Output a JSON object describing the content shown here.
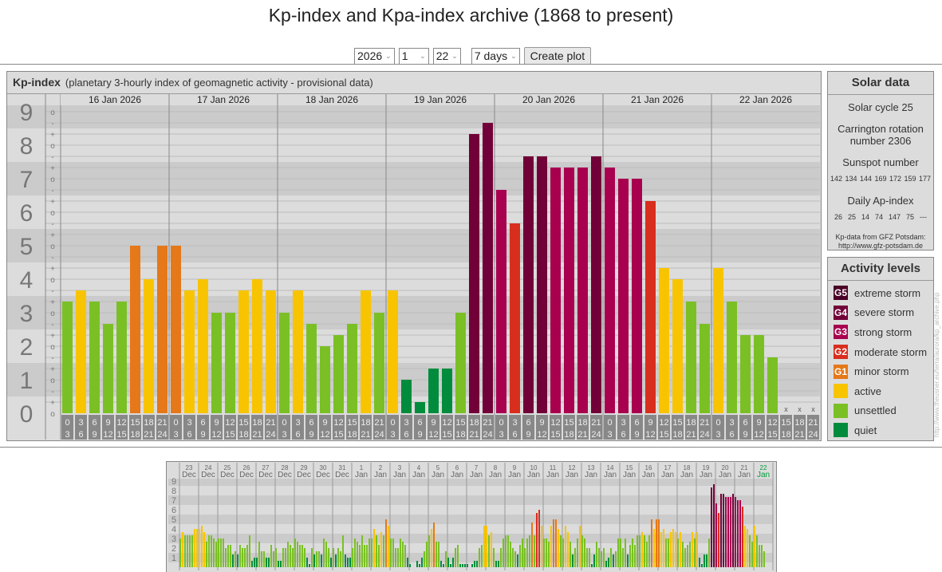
{
  "page_title": "Kp-index and Kpa-index archive (1868 to present)",
  "controls": {
    "year": "2026",
    "month": "1",
    "day": "22",
    "range": "7 days",
    "create_label": "Create plot"
  },
  "kp_panel": {
    "title": "Kp-index",
    "subtitle": "(planetary 3-hourly index of geomagnetic activity - provisional data)"
  },
  "solar": {
    "title": "Solar data",
    "cycle": "Solar cycle 25",
    "carrington": "Carrington rotation number 2306",
    "sunspot_label": "Sunspot number",
    "sunspot_values": "142 134 144 169 172 159 177",
    "ap_label": "Daily Ap-index",
    "ap_values": "26  25  14  74  147  75  ---",
    "source_line1": "Kp-data from GFZ Potsdam:",
    "source_line2": "http://www.gfz-potsdam.de"
  },
  "legend": {
    "title": "Activity levels",
    "items": [
      {
        "badge": "G5",
        "label": "extreme storm",
        "color": "#4a0026"
      },
      {
        "badge": "G4",
        "label": "severe storm",
        "color": "#720038"
      },
      {
        "badge": "G3",
        "label": "strong storm",
        "color": "#a8004f"
      },
      {
        "badge": "G2",
        "label": "moderate storm",
        "color": "#d82e1e"
      },
      {
        "badge": "G1",
        "label": "minor storm",
        "color": "#e57818"
      },
      {
        "badge": "",
        "label": "active",
        "color": "#f8c400"
      },
      {
        "badge": "",
        "label": "unsettled",
        "color": "#7ac025"
      },
      {
        "badge": "",
        "label": "quiet",
        "color": "#008c3c"
      }
    ]
  },
  "side_url": "http://www.theusner.eu/terra/aurora/kp_archive.php",
  "chart_data": [
    {
      "type": "bar",
      "title": "Kp-index",
      "ylim": [
        0,
        9
      ],
      "y_ticks": [
        "0",
        "1",
        "2",
        "3",
        "4",
        "5",
        "6",
        "7",
        "8",
        "9"
      ],
      "y_subticks": [
        "-",
        "o",
        "+"
      ],
      "missing_marker": "x",
      "hours": [
        [
          "0",
          "3"
        ],
        [
          "3",
          "6"
        ],
        [
          "6",
          "9"
        ],
        [
          "9",
          "12"
        ],
        [
          "12",
          "15"
        ],
        [
          "15",
          "18"
        ],
        [
          "18",
          "21"
        ],
        [
          "21",
          "24"
        ]
      ],
      "days": [
        {
          "label": "16 Jan 2026",
          "values": [
            "3+",
            "4-",
            "3+",
            "3-",
            "3+",
            "5o",
            "4o",
            "5o"
          ]
        },
        {
          "label": "17 Jan 2026",
          "values": [
            "5o",
            "4-",
            "4o",
            "3o",
            "3o",
            "4-",
            "4o",
            "4-"
          ]
        },
        {
          "label": "18 Jan 2026",
          "values": [
            "3o",
            "4-",
            "3-",
            "2o",
            "2+",
            "3-",
            "4-",
            "3o"
          ]
        },
        {
          "label": "19 Jan 2026",
          "values": [
            "4-",
            "1o",
            "0+",
            "1+",
            "1+",
            "3o",
            "8+",
            "9-"
          ]
        },
        {
          "label": "20 Jan 2026",
          "values": [
            "7-",
            "6-",
            "8-",
            "8-",
            "7+",
            "7+",
            "7+",
            "8-"
          ]
        },
        {
          "label": "21 Jan 2026",
          "values": [
            "7+",
            "7o",
            "7o",
            "6+",
            "4+",
            "4o",
            "3+",
            "3-"
          ]
        },
        {
          "label": "22 Jan 2026",
          "values": [
            "4+",
            "3+",
            "2+",
            "2+",
            "2-",
            "x",
            "x",
            "x"
          ]
        }
      ]
    },
    {
      "type": "bar",
      "ylim": [
        0,
        9
      ],
      "y_ticks": [
        "1",
        "2",
        "3",
        "4",
        "5",
        "6",
        "7",
        "8",
        "9"
      ],
      "days": [
        {
          "day": "23",
          "month": "Dec",
          "values": [
            "3o",
            "4-",
            "3+",
            "3+",
            "3+",
            "3+",
            "4o",
            "4o"
          ]
        },
        {
          "day": "24",
          "month": "Dec",
          "values": [
            "4o",
            "4+",
            "4-",
            "3-",
            "3+",
            "3+",
            "3o",
            "3-"
          ]
        },
        {
          "day": "25",
          "month": "Dec",
          "values": [
            "3o",
            "3o",
            "3o",
            "2o",
            "2+",
            "2+",
            "1+",
            "2-"
          ]
        },
        {
          "day": "26",
          "month": "Dec",
          "values": [
            "1+",
            "2+",
            "2o",
            "2o",
            "2+",
            "3+",
            "1-",
            "1o"
          ]
        },
        {
          "day": "27",
          "month": "Dec",
          "values": [
            "1o",
            "3-",
            "2-",
            "2-",
            "1o",
            "1o",
            "2+",
            "2-"
          ]
        },
        {
          "day": "28",
          "month": "Dec",
          "values": [
            "2o",
            "1-",
            "1-",
            "2o",
            "2o",
            "3-",
            "2+",
            "2o"
          ]
        },
        {
          "day": "29",
          "month": "Dec",
          "values": [
            "3o",
            "3-",
            "2+",
            "2+",
            "2o",
            "1o",
            "0+",
            "2o"
          ]
        },
        {
          "day": "30",
          "month": "Dec",
          "values": [
            "1+",
            "2-",
            "2-",
            "1+",
            "3o",
            "3-",
            "2o",
            "1o"
          ]
        },
        {
          "day": "31",
          "month": "Dec",
          "values": [
            "2o",
            "1+",
            "2o",
            "2-",
            "3+",
            "1+",
            "1o",
            "1o"
          ]
        },
        {
          "day": "1",
          "month": "Jan",
          "values": [
            "2o",
            "3o",
            "3-",
            "2+",
            "3+",
            "2+",
            "2+",
            "3o"
          ]
        },
        {
          "day": "2",
          "month": "Jan",
          "values": [
            "3o",
            "4o",
            "3+",
            "2+",
            "4-",
            "3+",
            "5o",
            "4+"
          ]
        },
        {
          "day": "3",
          "month": "Jan",
          "values": [
            "3o",
            "3o",
            "2o",
            "2o",
            "3o",
            "3-",
            "2+",
            "1o"
          ]
        },
        {
          "day": "4",
          "month": "Jan",
          "values": [
            "0+",
            "0o",
            "0o",
            "1-",
            "0+",
            "1o",
            "2-",
            "3-"
          ]
        },
        {
          "day": "5",
          "month": "Jan",
          "values": [
            "3+",
            "4o",
            "5-",
            "3-",
            "3-",
            "1-",
            "0+",
            "2-"
          ]
        },
        {
          "day": "6",
          "month": "Jan",
          "values": [
            "1o",
            "0+",
            "1o",
            "2o",
            "2+",
            "0+",
            "0+",
            "0+"
          ]
        },
        {
          "day": "7",
          "month": "Jan",
          "values": [
            "0+",
            "0o",
            "0+",
            "1-",
            "1-",
            "2o",
            "2+",
            "4+"
          ]
        },
        {
          "day": "8",
          "month": "Jan",
          "values": [
            "4+",
            "3+",
            "4-",
            "2o",
            "1-",
            "1-",
            "2o",
            "3o"
          ]
        },
        {
          "day": "9",
          "month": "Jan",
          "values": [
            "3+",
            "3+",
            "3-",
            "2o",
            "2-",
            "1+",
            "2+",
            "3o"
          ]
        },
        {
          "day": "10",
          "month": "Jan",
          "values": [
            "2o",
            "3o",
            "3+",
            "5-",
            "3+",
            "6-",
            "6o",
            "4+"
          ]
        },
        {
          "day": "11",
          "month": "Jan",
          "values": [
            "3o",
            "3o",
            "3-",
            "4+",
            "5o",
            "5o",
            "4o",
            "3+"
          ]
        },
        {
          "day": "12",
          "month": "Jan",
          "values": [
            "3o",
            "4+",
            "4-",
            "3-",
            "1+",
            "2o",
            "3o",
            "4+"
          ]
        },
        {
          "day": "13",
          "month": "Jan",
          "values": [
            "3+",
            "3o",
            "2o",
            "2o",
            "0+",
            "1+",
            "3-",
            "2o"
          ]
        },
        {
          "day": "14",
          "month": "Jan",
          "values": [
            "2-",
            "2o",
            "1-",
            "1o",
            "2o",
            "1+",
            "2-",
            "3o"
          ]
        },
        {
          "day": "15",
          "month": "Jan",
          "values": [
            "3o",
            "2o",
            "3o",
            "1+",
            "2+",
            "3o",
            "2+",
            "3+"
          ]
        },
        {
          "day": "16",
          "month": "Jan",
          "values": [
            "3+",
            "4-",
            "3+",
            "3-",
            "3+",
            "5o",
            "4o",
            "5o"
          ]
        },
        {
          "day": "17",
          "month": "Jan",
          "values": [
            "5o",
            "4-",
            "4o",
            "3o",
            "3o",
            "4-",
            "4o",
            "4-"
          ]
        },
        {
          "day": "18",
          "month": "Jan",
          "values": [
            "3o",
            "4-",
            "3-",
            "2o",
            "2+",
            "3-",
            "4-",
            "3o"
          ]
        },
        {
          "day": "19",
          "month": "Jan",
          "values": [
            "4-",
            "1o",
            "0+",
            "1+",
            "1+",
            "3o",
            "8+",
            "9-"
          ]
        },
        {
          "day": "20",
          "month": "Jan",
          "values": [
            "7-",
            "6-",
            "8-",
            "8-",
            "7+",
            "7+",
            "7+",
            "8-"
          ]
        },
        {
          "day": "21",
          "month": "Jan",
          "values": [
            "7+",
            "7o",
            "7o",
            "6+",
            "4+",
            "4o",
            "3+",
            "3-"
          ]
        },
        {
          "day": "22",
          "month": "Jan",
          "current": true,
          "values": [
            "4+",
            "3+",
            "2+",
            "2+",
            "2-"
          ]
        }
      ]
    }
  ]
}
